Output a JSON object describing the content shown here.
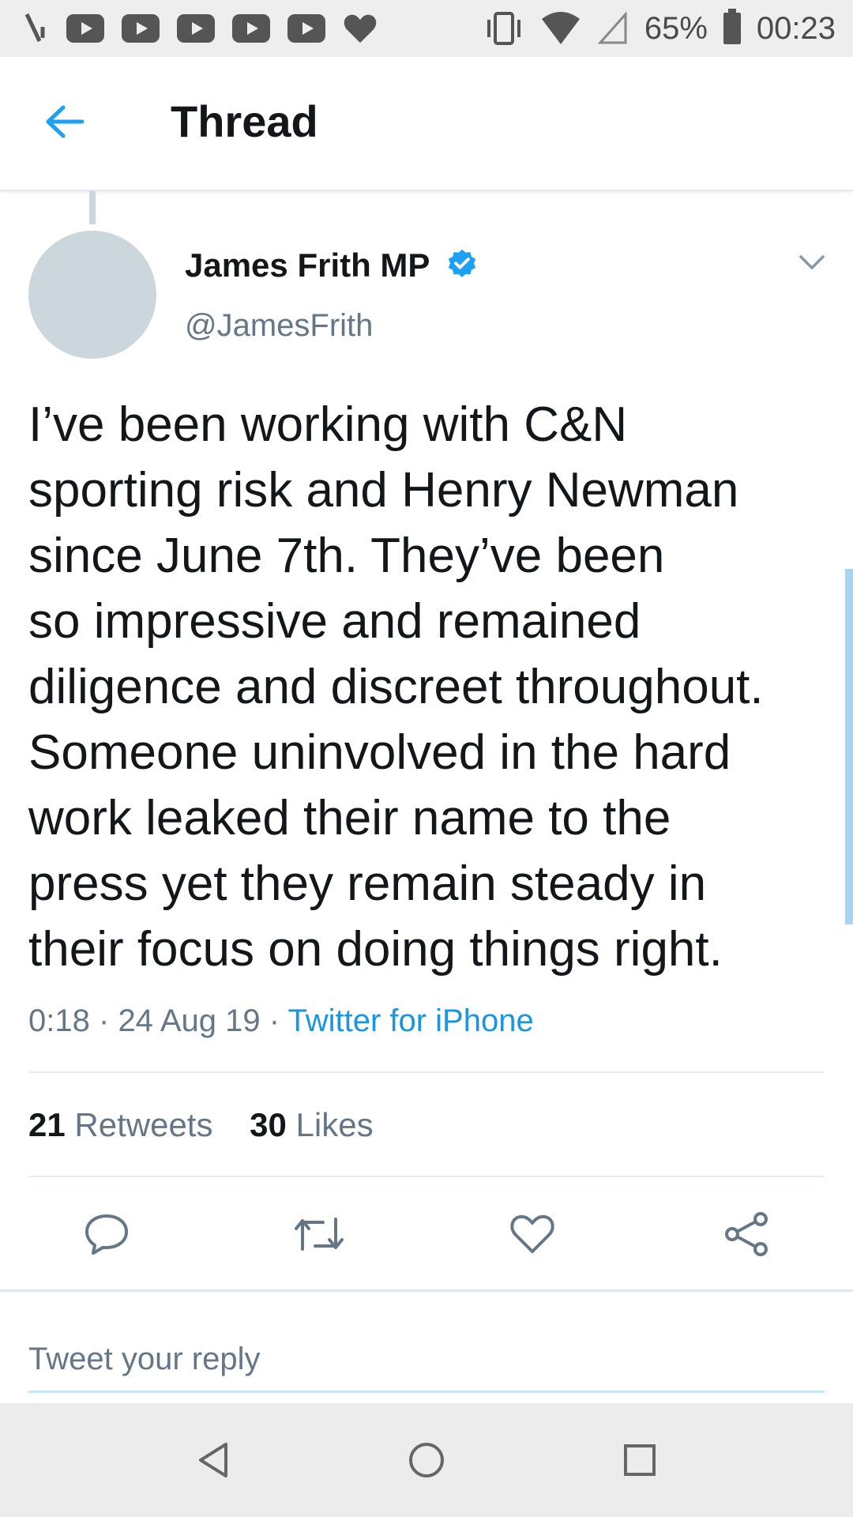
{
  "status_bar": {
    "battery": "65%",
    "time": "00:23"
  },
  "header": {
    "title": "Thread"
  },
  "tweet": {
    "author_name": "James Frith MP",
    "handle": "@JamesFrith",
    "text": "I’ve been working with C&N\nsporting risk and Henry Newman\nsince June 7th. They’ve been\nso impressive and remained\ndiligence and discreet throughout.\nSomeone uninvolved in the hard\nwork leaked their name to the\npress yet they remain steady in\ntheir focus on doing things right.",
    "time": "0:18",
    "date": "24 Aug 19",
    "separator": "·",
    "source": "Twitter for iPhone",
    "retweets_count": "21",
    "retweets_label": "Retweets",
    "likes_count": "30",
    "likes_label": "Likes"
  },
  "reply": {
    "placeholder": "Tweet your reply"
  },
  "colors": {
    "accent": "#1da1f2",
    "link": "#1b95e0",
    "secondary_text": "#657786",
    "avatar_placeholder": "#ccd6dd"
  },
  "icons": {
    "back": "arrow-left-icon",
    "verified": "verified-badge-icon",
    "caret": "chevron-down-icon",
    "reply": "comment-icon",
    "retweet": "retweet-icon",
    "like": "heart-icon",
    "share": "share-icon"
  }
}
